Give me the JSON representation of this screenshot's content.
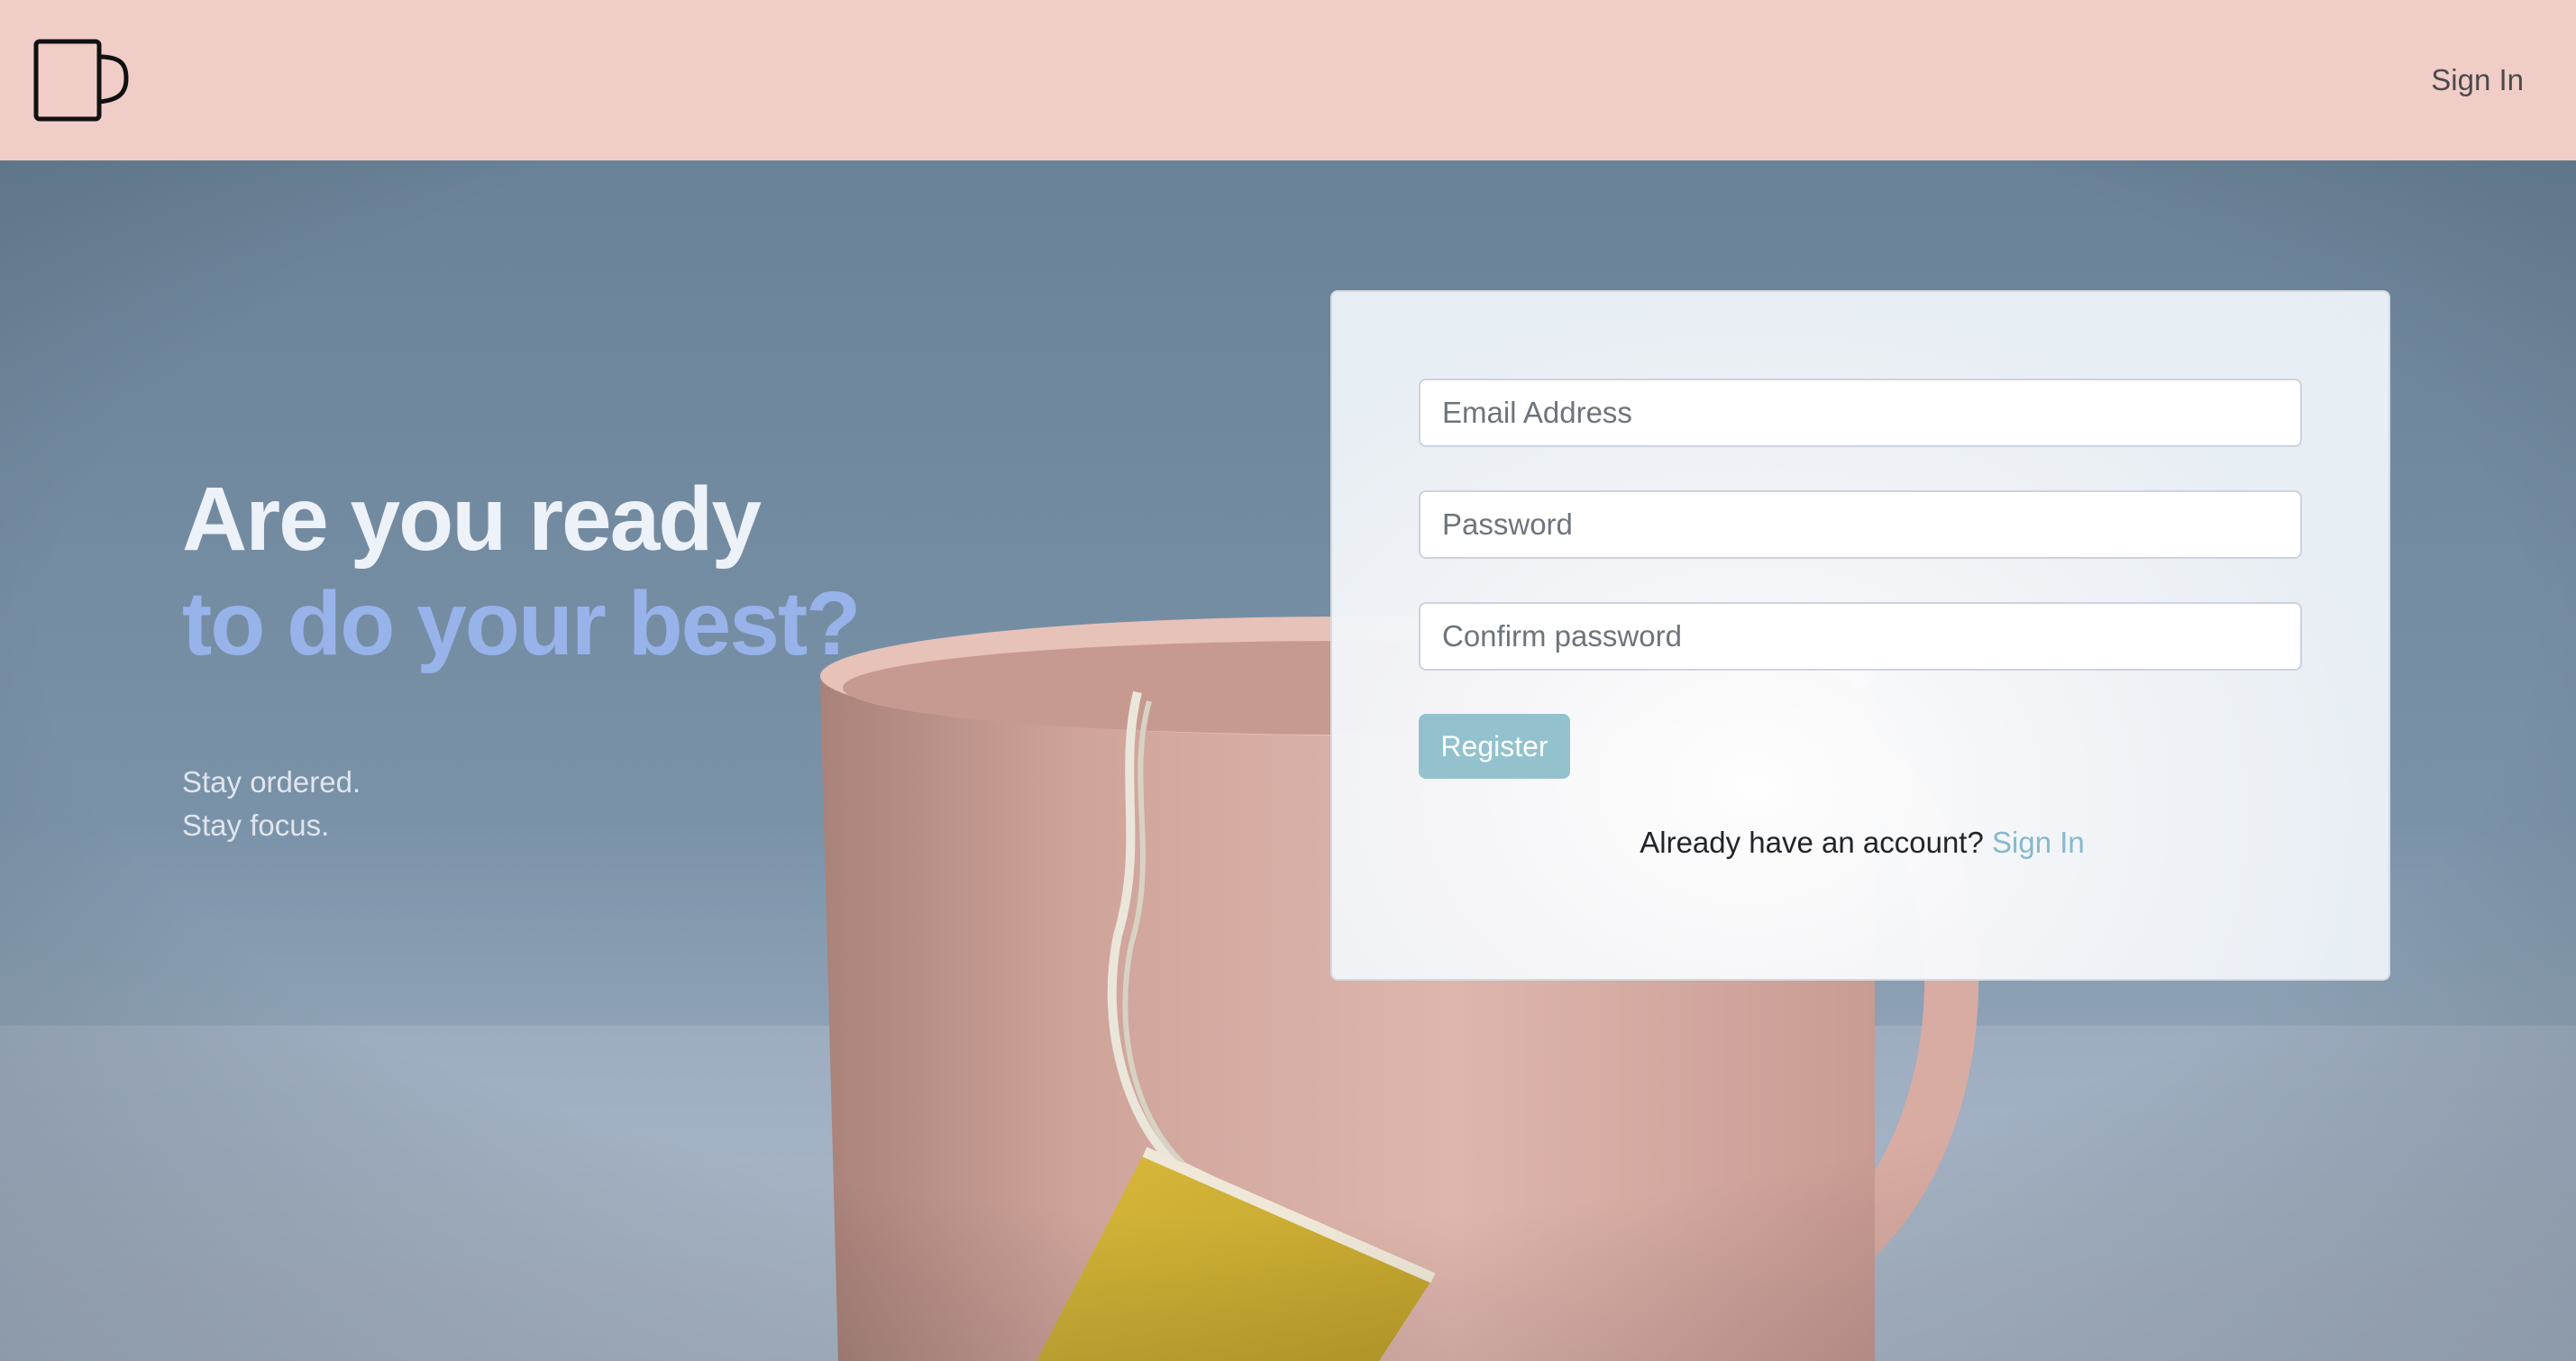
{
  "header": {
    "logo_icon": "mug-icon",
    "signin_label": "Sign In",
    "background": "#f1cdc7"
  },
  "hero": {
    "title_line1": "Are you ready",
    "title_line2": "to do your best?",
    "tagline_line1": "Stay ordered.",
    "tagline_line2": "Stay focus.",
    "title_color": "#edf1f8",
    "accent_color": "#98b3ea"
  },
  "form": {
    "email_placeholder": "Email Address",
    "email_value": "",
    "password_placeholder": "Password",
    "password_value": "",
    "confirm_placeholder": "Confirm password",
    "confirm_value": "",
    "register_label": "Register",
    "already_text": "Already have an account?",
    "signin_link": "Sign In",
    "button_color": "#93c2ce"
  }
}
